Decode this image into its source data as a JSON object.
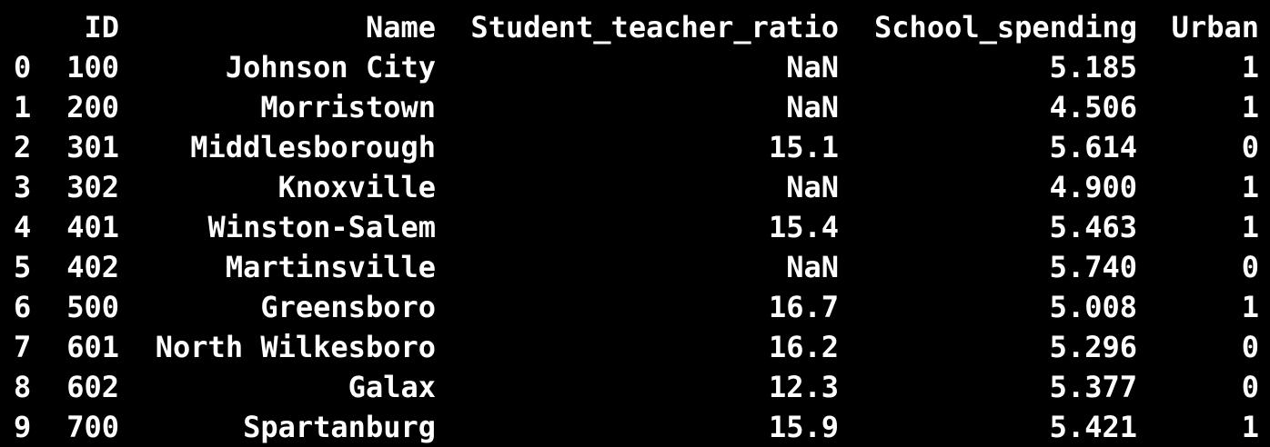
{
  "dataframe": {
    "columns": {
      "id": "ID",
      "name": "Name",
      "ratio": "Student_teacher_ratio",
      "spending": "School_spending",
      "urban": "Urban"
    },
    "rows": [
      {
        "index": "0",
        "id": "100",
        "name": "Johnson City",
        "ratio": "NaN",
        "spending": "5.185",
        "urban": "1"
      },
      {
        "index": "1",
        "id": "200",
        "name": "Morristown",
        "ratio": "NaN",
        "spending": "4.506",
        "urban": "1"
      },
      {
        "index": "2",
        "id": "301",
        "name": "Middlesborough",
        "ratio": "15.1",
        "spending": "5.614",
        "urban": "0"
      },
      {
        "index": "3",
        "id": "302",
        "name": "Knoxville",
        "ratio": "NaN",
        "spending": "4.900",
        "urban": "1"
      },
      {
        "index": "4",
        "id": "401",
        "name": "Winston-Salem",
        "ratio": "15.4",
        "spending": "5.463",
        "urban": "1"
      },
      {
        "index": "5",
        "id": "402",
        "name": "Martinsville",
        "ratio": "NaN",
        "spending": "5.740",
        "urban": "0"
      },
      {
        "index": "6",
        "id": "500",
        "name": "Greensboro",
        "ratio": "16.7",
        "spending": "5.008",
        "urban": "1"
      },
      {
        "index": "7",
        "id": "601",
        "name": "North Wilkesboro",
        "ratio": "16.2",
        "spending": "5.296",
        "urban": "0"
      },
      {
        "index": "8",
        "id": "602",
        "name": "Galax",
        "ratio": "12.3",
        "spending": "5.377",
        "urban": "0"
      },
      {
        "index": "9",
        "id": "700",
        "name": "Spartanburg",
        "ratio": "15.9",
        "spending": "5.421",
        "urban": "1"
      }
    ]
  },
  "colors": {
    "background": "#000000",
    "text": "#ffffff"
  }
}
